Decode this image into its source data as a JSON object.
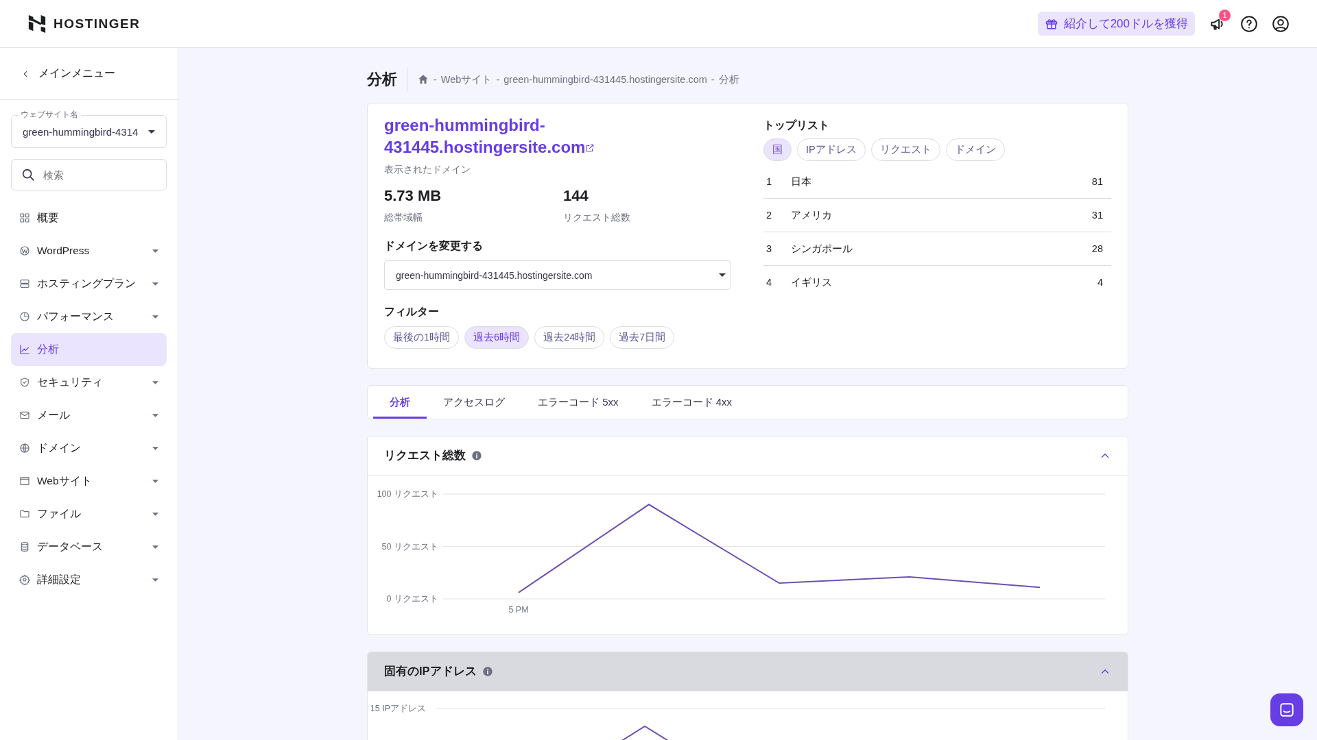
{
  "header": {
    "logo": "HOSTINGER",
    "referral_button": "紹介して200ドルを獲得",
    "notification_count": "1"
  },
  "sidebar": {
    "back_link": "メインメニュー",
    "website_field": {
      "label": "ウェブサイト名",
      "value": "green-hummingbird-4314"
    },
    "search": {
      "placeholder": "検索"
    },
    "items": [
      {
        "label": "概要",
        "kind": "link",
        "selected": false
      },
      {
        "label": "WordPress",
        "kind": "dropdown",
        "selected": false
      },
      {
        "label": "ホスティングプラン",
        "kind": "dropdown",
        "selected": false
      },
      {
        "label": "パフォーマンス",
        "kind": "dropdown",
        "selected": false
      },
      {
        "label": "分析",
        "kind": "link",
        "selected": true
      },
      {
        "label": "セキュリティ",
        "kind": "dropdown",
        "selected": false
      },
      {
        "label": "メール",
        "kind": "dropdown",
        "selected": false
      },
      {
        "label": "ドメイン",
        "kind": "dropdown",
        "selected": false
      },
      {
        "label": "Webサイト",
        "kind": "dropdown",
        "selected": false
      },
      {
        "label": "ファイル",
        "kind": "dropdown",
        "selected": false
      },
      {
        "label": "データベース",
        "kind": "dropdown",
        "selected": false
      },
      {
        "label": "詳細設定",
        "kind": "dropdown",
        "selected": false
      }
    ]
  },
  "page": {
    "title": "分析",
    "breadcrumb_separator": "-",
    "breadcrumb": [
      "Webサイト",
      "green-hummingbird-431445.hostingersite.com",
      "分析"
    ]
  },
  "overview": {
    "domain": "green-hummingbird-431445.hostingersite.com",
    "domain_caption": "表示されたドメイン",
    "stats": [
      {
        "value": "5.73 MB",
        "label": "総帯域幅"
      },
      {
        "value": "144",
        "label": "リクエスト総数"
      }
    ],
    "change_domain": {
      "heading": "ドメインを変更する",
      "value": "green-hummingbird-431445.hostingersite.com"
    },
    "filters": {
      "heading": "フィルター",
      "options": [
        {
          "label": "最後の1時間",
          "selected": false
        },
        {
          "label": "過去6時間",
          "selected": true
        },
        {
          "label": "過去24時間",
          "selected": false
        },
        {
          "label": "過去7日間",
          "selected": false
        }
      ]
    }
  },
  "top_list": {
    "heading": "トップリスト",
    "tabs": [
      {
        "label": "国",
        "selected": true
      },
      {
        "label": "IPアドレス",
        "selected": false
      },
      {
        "label": "リクエスト",
        "selected": false
      },
      {
        "label": "ドメイン",
        "selected": false
      }
    ],
    "rows": [
      {
        "rank": "1",
        "name": "日本",
        "count": "81"
      },
      {
        "rank": "2",
        "name": "アメリカ",
        "count": "31"
      },
      {
        "rank": "3",
        "name": "シンガポール",
        "count": "28"
      },
      {
        "rank": "4",
        "name": "イギリス",
        "count": "4"
      }
    ]
  },
  "tabs": [
    {
      "label": "分析",
      "selected": true
    },
    {
      "label": "アクセスログ",
      "selected": false
    },
    {
      "label": "エラーコード 5xx",
      "selected": false
    },
    {
      "label": "エラーコード 4xx",
      "selected": false
    }
  ],
  "panels": [
    {
      "title": "リクエスト総数",
      "expanded": true,
      "highlighted": false,
      "x_tick_labels": [
        "5 PM"
      ],
      "chart_data": {
        "type": "line",
        "ylim": [
          0,
          100
        ],
        "yticks": [
          {
            "value": 0,
            "label": "0 リクエスト"
          },
          {
            "value": 50,
            "label": "50 リクエスト"
          },
          {
            "value": 100,
            "label": "100 リクエスト"
          }
        ],
        "series": [
          {
            "color": "#6e4fb3",
            "values": [
              6,
              90,
              15,
              21,
              11
            ]
          }
        ]
      }
    },
    {
      "title": "固有のIPアドレス",
      "expanded": true,
      "highlighted": true,
      "y_tick_labels": [
        "15 IPアドレス"
      ]
    }
  ]
}
